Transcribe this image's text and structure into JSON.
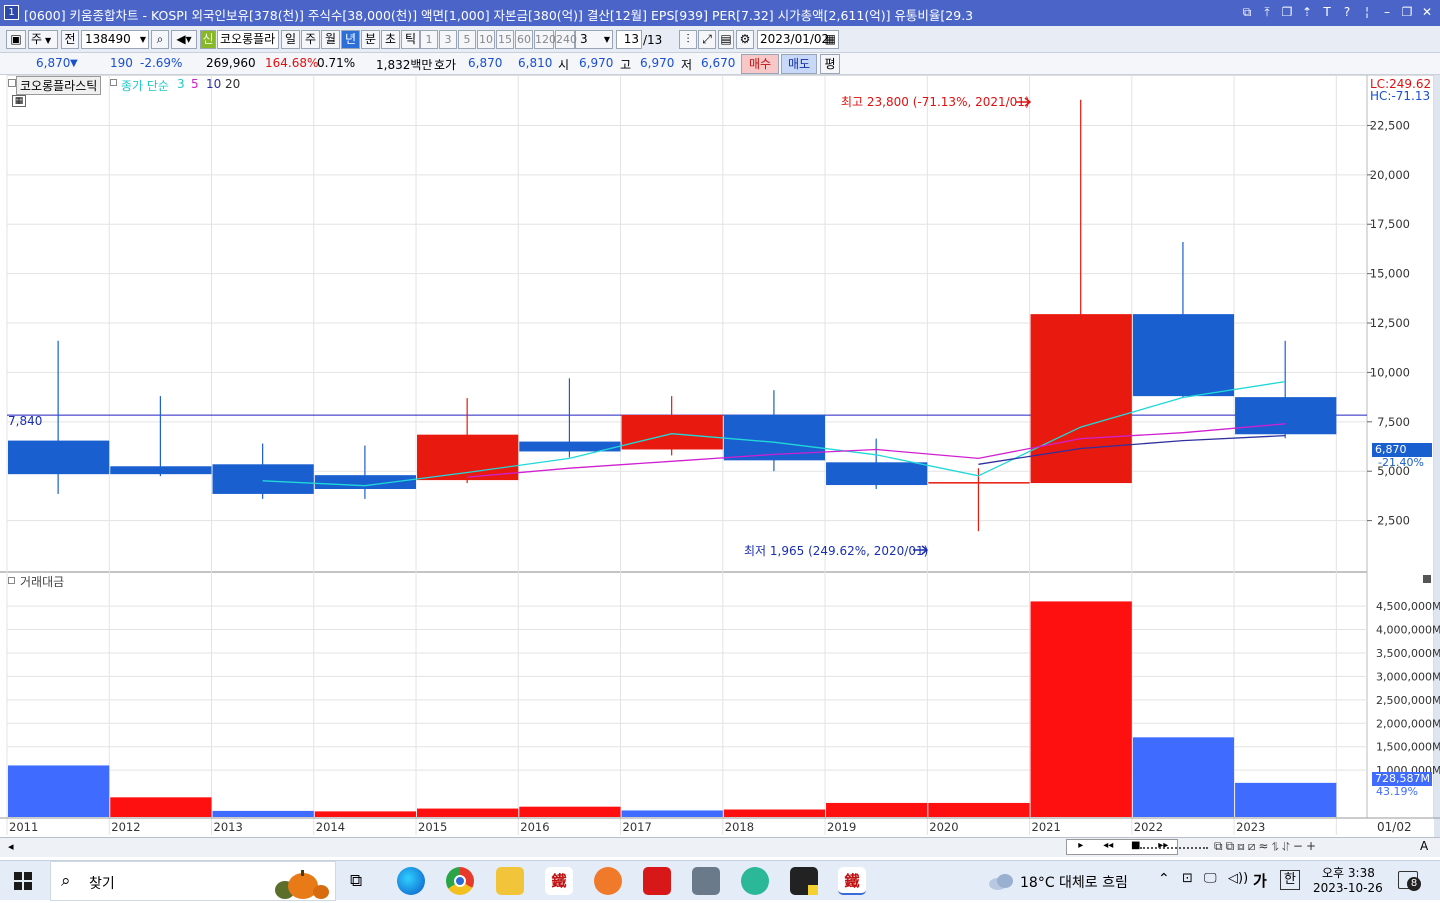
{
  "window": {
    "number": "1",
    "title": "[0600] 키움종합차트 - KOSPI 외국인보유[378(천)] 주식수[38,000(천)] 액면[1,000] 자본금[380(억)] 결산[12월] EPS[939] PER[7.32] 시가총액[2,611(억)] 유통비율[29.3"
  },
  "toolbar": {
    "period_week": "주",
    "prev": "전",
    "code": "138490",
    "new_badge": "신",
    "stock_name": "코오롱플라",
    "tabs": [
      "일",
      "주",
      "월",
      "년",
      "분",
      "초",
      "틱"
    ],
    "active_tab": "년",
    "intervals": [
      "1",
      "3",
      "5",
      "10",
      "15",
      "60",
      "120",
      "240"
    ],
    "count": "3",
    "page": "13",
    "page_total": "/13",
    "date": "2023/01/02"
  },
  "infobar": {
    "price": "6,870",
    "down_arrow": "▼",
    "change": "190",
    "change_pct": "-2.69%",
    "volume": "269,960",
    "vol_ratio": "164.68%",
    "turnover": "0.71%",
    "amount": "1,832백만",
    "hoga_label": "호가",
    "hoga1": "6,870",
    "hoga2": "6,810",
    "open_label": "시",
    "open": "6,970",
    "high_label": "고",
    "high": "6,970",
    "low_label": "저",
    "low": "6,670",
    "buy": "매수",
    "sell": "매도",
    "avg": "평"
  },
  "chart": {
    "legend_name": "코오롱플라스틱",
    "ma_label": "종가 단순",
    "ma_periods": [
      "3",
      "5",
      "10",
      "20"
    ],
    "lc": "LC:249.62",
    "hc": "HC:-71.13",
    "max_annotation": "최고 23,800 (-71.13%, 2021/01)",
    "min_annotation": "최저 1,965 (249.62%, 2020/01)",
    "hline_label": "7,840",
    "current_price_tag": "6,870",
    "current_pct_tag": "-21.40%",
    "volume_panel_title": "거래대금",
    "volume_last_tag": "728,587M",
    "volume_pct_tag": "43.19%",
    "last_axis_label": "01/02",
    "colors": {
      "up": "#e8190f",
      "down": "#1a5fcf",
      "vol_up": "#ff1010",
      "vol_down": "#3f6bff",
      "ma3": "#20d8d8",
      "ma5": "#d020d0",
      "ma10": "#3030a0",
      "ma20": "#606060",
      "hline": "#2020c0"
    }
  },
  "chart_data": {
    "type": "candlestick",
    "title": "",
    "x": [
      "2011",
      "2012",
      "2013",
      "2014",
      "2015",
      "2016",
      "2017",
      "2018",
      "2019",
      "2020",
      "2021",
      "2022",
      "2023"
    ],
    "ohlc": [
      {
        "o": 6550,
        "h": 11600,
        "l": 3850,
        "c": 4850
      },
      {
        "o": 5250,
        "h": 8800,
        "l": 4750,
        "c": 4850
      },
      {
        "o": 5350,
        "h": 6400,
        "l": 3600,
        "c": 3850
      },
      {
        "o": 4800,
        "h": 6300,
        "l": 3600,
        "c": 4100
      },
      {
        "o": 4550,
        "h": 8700,
        "l": 4400,
        "c": 6850
      },
      {
        "o": 6500,
        "h": 9700,
        "l": 5700,
        "c": 6000
      },
      {
        "o": 6100,
        "h": 8800,
        "l": 5800,
        "c": 7850
      },
      {
        "o": 7850,
        "h": 9100,
        "l": 5000,
        "c": 5550
      },
      {
        "o": 5450,
        "h": 6650,
        "l": 4100,
        "c": 4300
      },
      {
        "o": 4400,
        "h": 5150,
        "l": 1965,
        "c": 4450
      },
      {
        "o": 4400,
        "h": 23800,
        "l": 4450,
        "c": 12950
      },
      {
        "o": 12950,
        "h": 16600,
        "l": 8750,
        "c": 8800
      },
      {
        "o": 8750,
        "h": 11600,
        "l": 6670,
        "c": 6870
      }
    ],
    "ma3": [
      null,
      null,
      4517,
      4267,
      4933,
      5650,
      6900,
      6467,
      5833,
      4767,
      7233,
      8733,
      9533
    ],
    "ma5": [
      null,
      null,
      null,
      null,
      4700,
      5150,
      5500,
      5850,
      6100,
      5650,
      6650,
      6950,
      7400
    ],
    "ma10": [
      null,
      null,
      null,
      null,
      null,
      null,
      null,
      null,
      null,
      5350,
      6150,
      6550,
      6800
    ],
    "volume_amount_m": [
      1100000,
      420000,
      130000,
      120000,
      180000,
      220000,
      140000,
      160000,
      300000,
      300000,
      4600000,
      1700000,
      728587
    ],
    "volume_up": [
      false,
      true,
      false,
      true,
      true,
      true,
      false,
      true,
      true,
      true,
      true,
      false,
      false
    ],
    "ylim": [
      0,
      24800
    ],
    "yticks": [
      2500,
      5000,
      7500,
      10000,
      12500,
      15000,
      17500,
      20000,
      22500
    ],
    "ytick_labels": [
      "2,500",
      "5,000",
      "7,500",
      "10,000",
      "12,500",
      "15,000",
      "17,500",
      "20,000",
      "22,500"
    ],
    "vol_yticks": [
      1000000,
      1500000,
      2000000,
      2500000,
      3000000,
      3500000,
      4000000,
      4500000
    ],
    "vol_ytick_labels": [
      "1,000,000M",
      "1,500,000M",
      "2,000,000M",
      "2,500,000M",
      "3,000,000M",
      "3,500,000M",
      "4,000,000M",
      "4,500,000M"
    ],
    "vol_ylim": [
      0,
      4950000
    ]
  },
  "taskbar": {
    "search": "찾기",
    "weather": "18°C 대체로 흐림",
    "ime1": "가",
    "ime2": "한",
    "time": "오후 3:38",
    "date": "2023-10-26",
    "notif": "8"
  }
}
